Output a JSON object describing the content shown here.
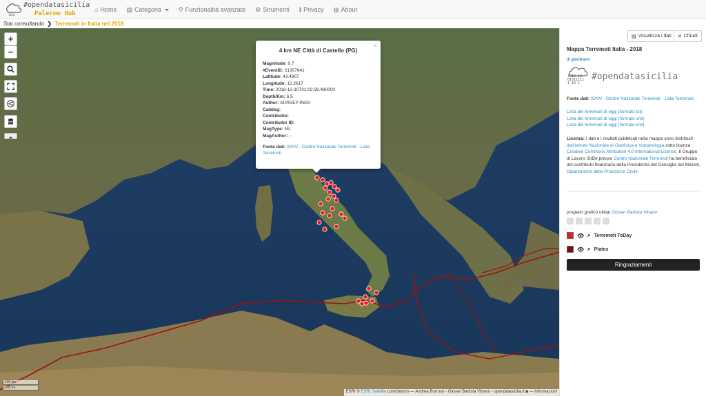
{
  "brand": {
    "title": "#opendatasicilia",
    "subtitle": "Palermo Hub"
  },
  "nav": [
    {
      "icon": "⌂",
      "label": "Home"
    },
    {
      "icon": "▤",
      "label": "Categoria"
    },
    {
      "icon": "⚲",
      "label": "Funzionalità avanzate"
    },
    {
      "icon": "⚙",
      "label": "Strumenti"
    },
    {
      "icon": "ℹ",
      "label": "Privacy"
    },
    {
      "icon": "◍",
      "label": "About"
    }
  ],
  "breadcrumb": {
    "prefix": "Stai consultando",
    "sep": "❯",
    "current": "Terremoti in Italia nel 2018"
  },
  "map": {
    "controls": {
      "zoom_in": "+",
      "zoom_out": "−",
      "search": "⚲",
      "fullscreen": "⛶",
      "share": "⇪",
      "layers": "≣"
    },
    "popup": {
      "close": "×",
      "title": "4 km NE Città di Castello (PG)",
      "fields": [
        {
          "label": "Magnitude:",
          "value": "0.7"
        },
        {
          "label": "#EventID:",
          "value": "21307641"
        },
        {
          "label": "Latitude:",
          "value": "43.4907"
        },
        {
          "label": "Longitude:",
          "value": "12.2617"
        },
        {
          "label": "Time:",
          "value": "2018-12-30T01:02:39.480000"
        },
        {
          "label": "Depth/Km:",
          "value": "6.5"
        },
        {
          "label": "Author:",
          "value": "SURVEY-INGV"
        },
        {
          "label": "Catalog:",
          "value": ""
        },
        {
          "label": "Contributor:",
          "value": ""
        },
        {
          "label": "Contributor ID:",
          "value": ""
        },
        {
          "label": "MagType:",
          "value": "ML"
        },
        {
          "label": "MagAuthor:",
          "value": "--"
        }
      ],
      "source_label": "Fonte dati:",
      "source_links": "IGNV - Centro Nazionale Terremoti - Lista Terremoti"
    },
    "scale": {
      "km": "100 km",
      "mi": "300 mi"
    },
    "attribution": {
      "esri": "ESRI ©",
      "sat": "ESRI Satellite",
      "rest": "contributors — Andrea Borruso - Giovan Battista Vitrano - opendatasicilia.it",
      "icon": "◙",
      "info": "— Informazioni"
    }
  },
  "sidebar": {
    "view_data": "Visualizza i dati",
    "close": "Chiudi",
    "title": "Mappa Terremoti Italia - 2018",
    "author_prefix": "di",
    "author": "gbvitrano",
    "logo_title": "#opendatasicilia",
    "logo_bin1": "1010 10",
    "logo_bin2": "01011111",
    "logo_bin3": "1 10 1",
    "fonte_label": "Fonte dati:",
    "fonte_links": "IGNV - Centro Nazionale Terremoti - Lista Terremoti",
    "links": [
      "Lista dei terremoti di oggi (formato txt)",
      "Lista dei terremoti di oggi (formato xml)",
      "Lista dei terremoti di oggi (formato kml)"
    ],
    "license_label": "Licenza:",
    "license_text1": "I dati e i risultati pubblicati nella mappa sono distribuiti",
    "license_link1": "dall'Istituto Nazionale di Geofisica e Vulcanologia",
    "license_text2": "sotto licenza",
    "license_link2": "Creative Commons Attribution 4.0 International License.",
    "license_text3": "Il Gruppo di Lavoro ISIDe presso",
    "license_link3": "Centro Nazionale Terremoti",
    "license_text4": "ha beneficiato del contributo finanziario della Presidenza del Consiglio dei Ministri,",
    "license_link4": "Dipartimento della Protezione Civile.",
    "credits_prefix": "progetto grafico uMap",
    "credits_name": "Giovan Battista Vitrano",
    "layers": [
      {
        "name": "Terremoti ToDay",
        "color": "#e81e1e"
      },
      {
        "name": "Plates",
        "color": "#7a0d0d"
      }
    ],
    "thanks": "Ringraziamenti"
  },
  "colors": {
    "accent": "#e8a200",
    "link": "#2a8fc9",
    "marker": "#e81e1e",
    "plate": "#a01010"
  }
}
